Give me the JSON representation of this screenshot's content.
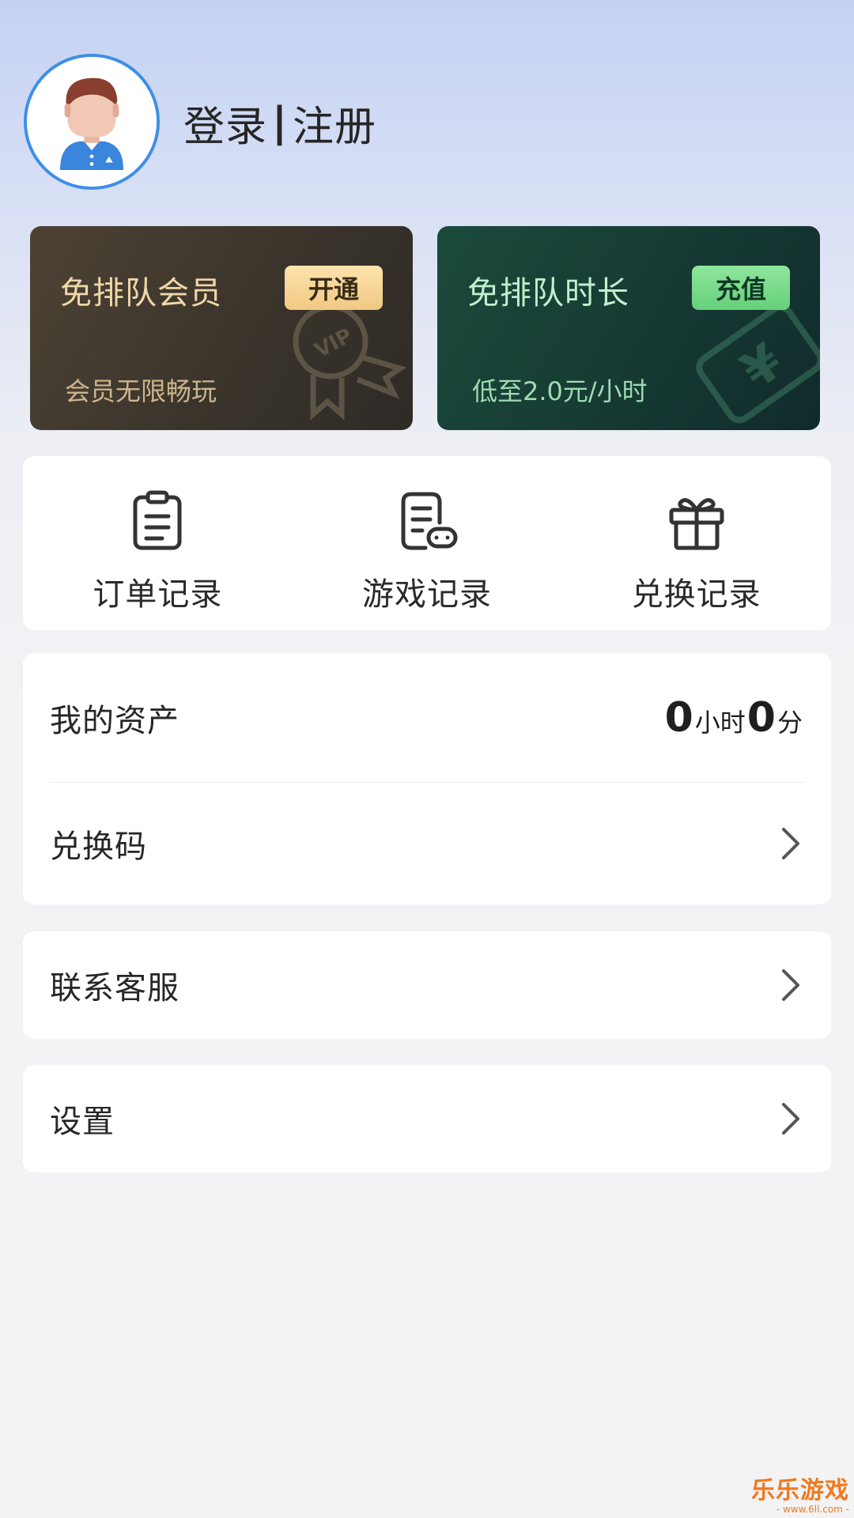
{
  "header": {
    "login_label": "登录",
    "separator": "|",
    "register_label": "注册"
  },
  "promos": {
    "vip": {
      "title": "免排队会员",
      "button": "开通",
      "subtitle": "会员无限畅玩",
      "badge_text": "VIP"
    },
    "time": {
      "title": "免排队时长",
      "button": "充值",
      "subtitle": "低至2.0元/小时",
      "badge_text": "¥"
    }
  },
  "records": [
    {
      "label": "订单记录",
      "icon": "clipboard-icon"
    },
    {
      "label": "游戏记录",
      "icon": "gamepad-doc-icon"
    },
    {
      "label": "兑换记录",
      "icon": "gift-icon"
    }
  ],
  "assets": {
    "label": "我的资产",
    "hours": "0",
    "hours_unit": "小时",
    "minutes": "0",
    "minutes_unit": "分"
  },
  "menu": {
    "redeem_code": "兑换码",
    "customer_service": "联系客服",
    "settings": "设置"
  },
  "watermark": {
    "title": "乐乐游戏",
    "url": "- www.6ll.com -"
  },
  "colors": {
    "avatar_border": "#3d8fe8",
    "vip_card": "#3a342b",
    "time_card": "#163a33",
    "vip_button": "#f1c883",
    "time_button": "#66cf7a",
    "watermark": "#f07a1f"
  }
}
